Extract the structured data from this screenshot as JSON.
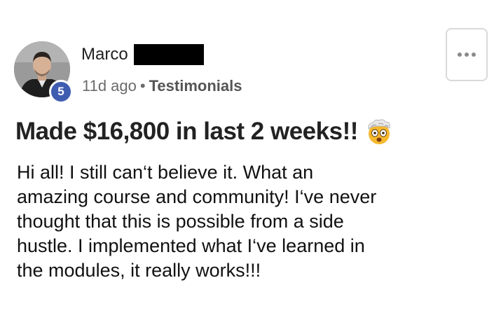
{
  "author": {
    "name": "Marco",
    "level": "5",
    "avatar_icon": "profile-photo-icon",
    "name_redacted": true
  },
  "meta": {
    "time_ago": "11d ago",
    "separator": "•",
    "category": "Testimonials"
  },
  "menu": {
    "icon": "more-horizontal-icon"
  },
  "post": {
    "title": "Made $16,800 in last 2 weeks!!",
    "title_emoji": "exploding-head-icon",
    "body": "Hi all! I still can‘t believe it. What an\namazing course and community! I‘ve never\nthought that this is possible from a side\nhustle. I implemented what I‘ve learned in\nthe modules, it really works!!!"
  },
  "colors": {
    "badge": "#3f5db0",
    "meta_text": "#6b6b6b",
    "border": "#d9d9d9"
  }
}
